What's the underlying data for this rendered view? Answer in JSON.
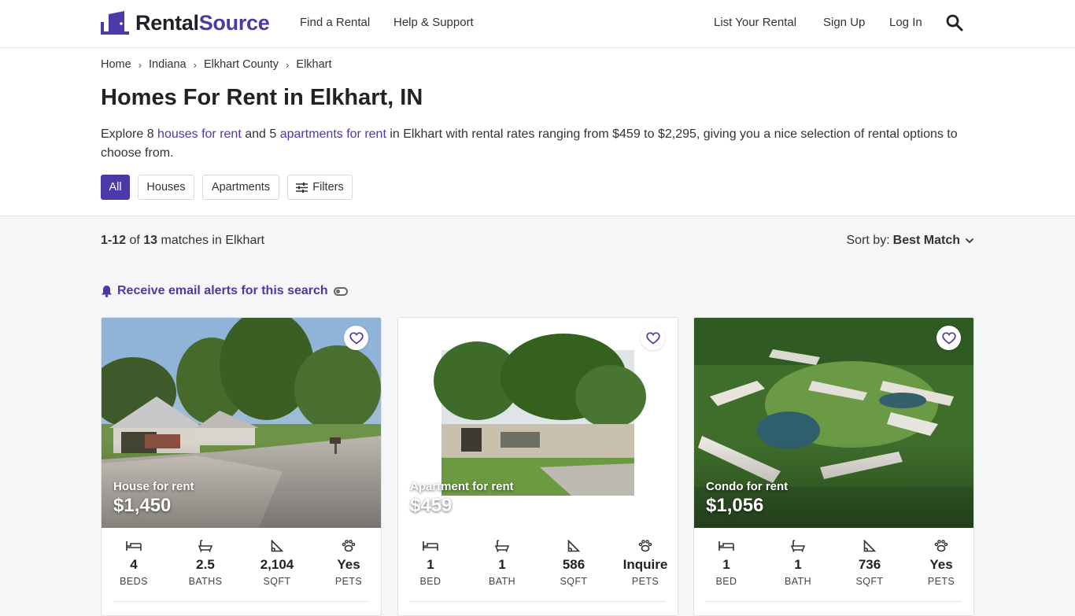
{
  "brand": {
    "name_a": "Rental",
    "name_b": "Source",
    "accent": "#4a3aa8"
  },
  "nav": {
    "find_rental": "Find a Rental",
    "help": "Help & Support",
    "list_rental": "List Your Rental",
    "sign_up": "Sign Up",
    "log_in": "Log In",
    "search_icon": "search-icon"
  },
  "breadcrumb": [
    "Home",
    "Indiana",
    "Elkhart County",
    "Elkhart"
  ],
  "page_title": "Homes For Rent in Elkhart, IN",
  "intro": {
    "t1": "Explore 8 ",
    "link1": "houses for rent",
    "t2": " and 5 ",
    "link2": "apartments for rent",
    "t3": " in Elkhart with rental rates ranging from $459 to $2,295, giving you a nice selection of rental options to choose from."
  },
  "filters": {
    "all": "All",
    "houses": "Houses",
    "apartments": "Apartments",
    "filters": "Filters"
  },
  "results": {
    "range": "1-12",
    "of": " of ",
    "total": "13",
    "suffix": " matches in Elkhart"
  },
  "sort": {
    "label": "Sort by:",
    "value": "Best Match"
  },
  "alert": {
    "label": "Receive email alerts for this search"
  },
  "listings": [
    {
      "type": "House for rent",
      "price": "$1,450",
      "beds": "4",
      "beds_label": "BEDS",
      "baths": "2.5",
      "baths_label": "BATHS",
      "sqft": "2,104",
      "sqft_label": "SQFT",
      "pets": "Yes",
      "pets_label": "PETS"
    },
    {
      "type": "Apartment for rent",
      "price": "$459",
      "beds": "1",
      "beds_label": "BED",
      "baths": "1",
      "baths_label": "BATH",
      "sqft": "586",
      "sqft_label": "SQFT",
      "pets": "Inquire",
      "pets_label": "PETS"
    },
    {
      "type": "Condo for rent",
      "price": "$1,056",
      "beds": "1",
      "beds_label": "BED",
      "baths": "1",
      "baths_label": "BATH",
      "sqft": "736",
      "sqft_label": "SQFT",
      "pets": "Yes",
      "pets_label": "PETS"
    }
  ]
}
